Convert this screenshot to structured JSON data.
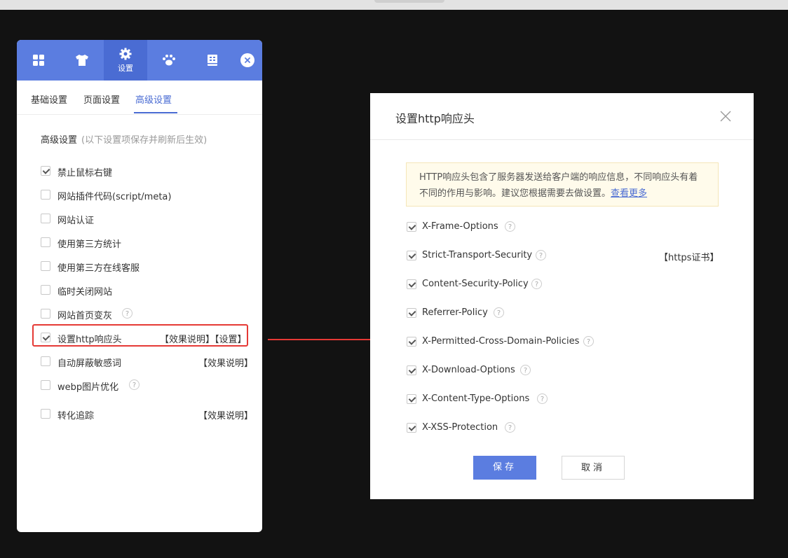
{
  "panel": {
    "tabs": [
      {
        "icon": "grid-icon",
        "label": ""
      },
      {
        "icon": "shirt-icon",
        "label": ""
      },
      {
        "icon": "gear-icon",
        "label": "设置"
      },
      {
        "icon": "paw-icon",
        "label": ""
      },
      {
        "icon": "book-icon",
        "label": ""
      }
    ],
    "subtabs": [
      "基础设置",
      "页面设置",
      "高级设置"
    ],
    "active_subtab": 2,
    "section_title": "高级设置",
    "section_note": "(以下设置项保存并刷新后生效)",
    "rows": [
      {
        "label": "禁止鼠标右键",
        "checked": true
      },
      {
        "label": "网站插件代码(script/meta)",
        "checked": false
      },
      {
        "label": "网站认证",
        "checked": false
      },
      {
        "label": "使用第三方统计",
        "checked": false
      },
      {
        "label": "使用第三方在线客服",
        "checked": false
      },
      {
        "label": "临时关闭网站",
        "checked": false
      },
      {
        "label": "网站首页变灰",
        "checked": false,
        "help": "?"
      },
      {
        "label": "设置http响应头",
        "checked": true,
        "links": "【效果说明】【设置】"
      },
      {
        "label": "自动屏蔽敏感词",
        "checked": false,
        "links": "【效果说明】"
      },
      {
        "label": "webp图片优化",
        "checked": false,
        "help": "?"
      },
      {
        "label": "转化追踪",
        "checked": false,
        "links": "【效果说明】"
      }
    ]
  },
  "modal": {
    "title": "设置http响应头",
    "notice_text": "HTTP响应头包含了服务器发送给客户端的响应信息，不同响应头有着不同的作用与影响。建议您根据需要去做设置。",
    "notice_link": "查看更多",
    "headers": [
      {
        "label": "X-Frame-Options",
        "checked": true,
        "help": "?"
      },
      {
        "label": "Strict-Transport-Security",
        "checked": true,
        "help": "?",
        "extra": "【https证书】"
      },
      {
        "label": "Content-Security-Policy",
        "checked": true,
        "help": "?"
      },
      {
        "label": "Referrer-Policy",
        "checked": true,
        "help": "?"
      },
      {
        "label": "X-Permitted-Cross-Domain-Policies",
        "checked": true,
        "help": "?"
      },
      {
        "label": "X-Download-Options",
        "checked": true,
        "help": "?"
      },
      {
        "label": "X-Content-Type-Options",
        "checked": true,
        "help": "?"
      },
      {
        "label": "X-XSS-Protection",
        "checked": true,
        "help": "?"
      }
    ],
    "save_label": "保存",
    "cancel_label": "取消"
  },
  "colors": {
    "accent": "#5b7de0",
    "highlight": "#e53935"
  }
}
